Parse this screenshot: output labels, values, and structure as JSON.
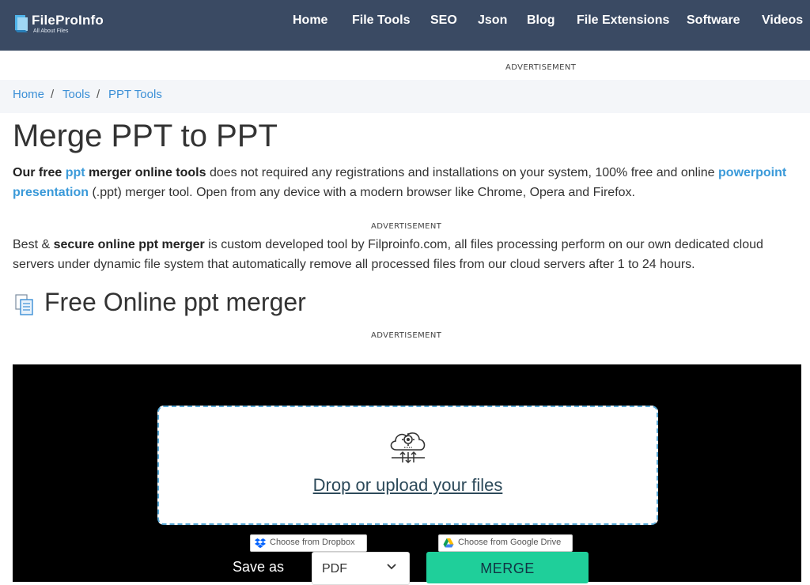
{
  "header": {
    "logo_title": "FileProInfo",
    "logo_subtitle": "All About Files",
    "nav": [
      "Home",
      "File Tools",
      "SEO",
      "Json",
      "Blog",
      "File Extensions",
      "Software",
      "Videos"
    ]
  },
  "ads": {
    "top": "ADVERTISEMENT",
    "middle": "ADVERTISEMENT",
    "tool": "ADVERTISEMENT"
  },
  "breadcrumb": [
    "Home",
    "Tools",
    "PPT Tools"
  ],
  "page_title": "Merge PPT to PPT",
  "intro": {
    "bold_1": "Our free",
    "link_1": "ppt",
    "bold_2": "merger online tools",
    "text_1": "does not required any registrations and installations on your system, 100% free and online",
    "link_2": "powerpoint presentation",
    "text_2": "(.ppt) merger tool. Open from any device with a modern browser like Chrome, Opera and Firefox."
  },
  "secure": {
    "text_1": "Best &",
    "bold": "secure online ppt merger",
    "text_2": "is custom developed tool by Filproinfo.com, all files processing perform on our own dedicated cloud servers under dynamic file system that automatically remove all processed files from our cloud servers after 1 to 24 hours."
  },
  "section_title": "Free Online ppt merger",
  "tool": {
    "drop_text": "Drop or upload your files",
    "dropbox_label": "Choose from Dropbox",
    "gdrive_label": "Choose from Google Drive",
    "save_as_label": "Save as",
    "format_value": "PDF",
    "merge_label": "MERGE"
  },
  "icons": {
    "logo": "book-logo-icon",
    "section": "document-icon",
    "drop": "cloud-upload-gear-icon",
    "dropbox": "dropbox-icon",
    "gdrive": "google-drive-icon",
    "select": "chevron-down-icon"
  },
  "colors": {
    "header_bg": "#3a4a63",
    "link": "#3b9ad9",
    "merge_button": "#1fcf9a",
    "tool_bg": "#000000"
  }
}
